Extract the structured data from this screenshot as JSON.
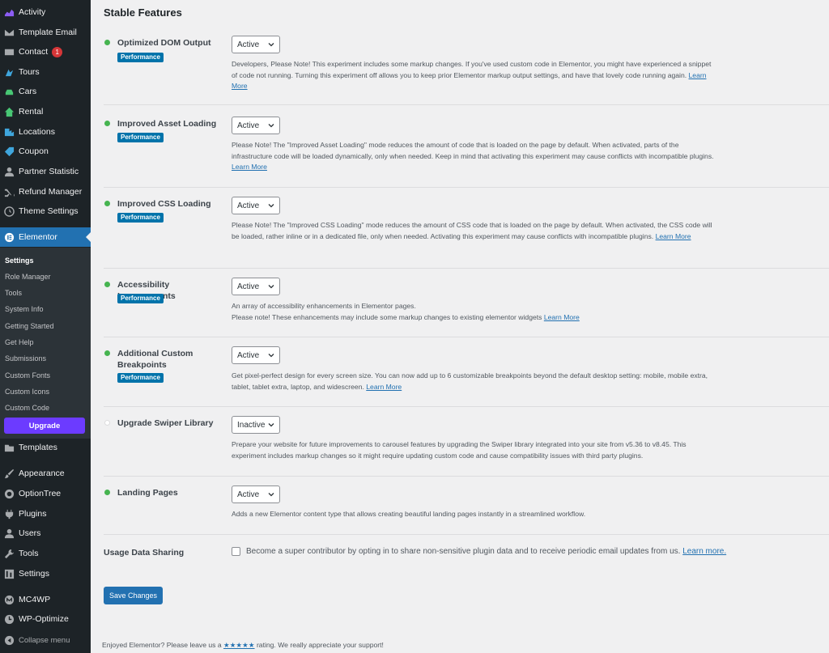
{
  "sidebar": {
    "items": [
      {
        "label": "Activity",
        "icon": "activity-icon"
      },
      {
        "label": "Template Email",
        "icon": "email-icon"
      },
      {
        "label": "Contact",
        "icon": "contact-icon",
        "badge": "1"
      },
      {
        "label": "Tours",
        "icon": "tours-icon"
      },
      {
        "label": "Cars",
        "icon": "car-icon"
      },
      {
        "label": "Rental",
        "icon": "rental-icon"
      },
      {
        "label": "Locations",
        "icon": "locations-icon"
      },
      {
        "label": "Coupon",
        "icon": "coupon-icon"
      },
      {
        "label": "Partner Statistic",
        "icon": "user-icon"
      },
      {
        "label": "Refund Manager",
        "icon": "shuffle-icon"
      },
      {
        "label": "Theme Settings",
        "icon": "settings-icon"
      },
      {
        "label": "Elementor",
        "icon": "elementor-icon",
        "current": true
      }
    ],
    "submenu": [
      {
        "label": "Settings",
        "active": true
      },
      {
        "label": "Role Manager"
      },
      {
        "label": "Tools"
      },
      {
        "label": "System Info"
      },
      {
        "label": "Getting Started"
      },
      {
        "label": "Get Help"
      },
      {
        "label": "Submissions"
      },
      {
        "label": "Custom Fonts"
      },
      {
        "label": "Custom Icons"
      },
      {
        "label": "Custom Code"
      }
    ],
    "upgrade_label": "Upgrade",
    "lower_items": [
      {
        "label": "Templates",
        "icon": "folder-icon"
      },
      {
        "label": "Appearance",
        "icon": "brush-icon"
      },
      {
        "label": "OptionTree",
        "icon": "optiontree-icon"
      },
      {
        "label": "Plugins",
        "icon": "plugin-icon"
      },
      {
        "label": "Users",
        "icon": "users-icon"
      },
      {
        "label": "Tools",
        "icon": "wrench-icon"
      },
      {
        "label": "Settings",
        "icon": "settings-sliders-icon"
      },
      {
        "label": "MC4WP",
        "icon": "mc4wp-icon"
      },
      {
        "label": "WP-Optimize",
        "icon": "optimize-icon"
      },
      {
        "label": "Collapse menu",
        "icon": "collapse-icon"
      }
    ]
  },
  "main": {
    "heading": "Stable Features",
    "tag_label": "Performance",
    "learn_more": "Learn More",
    "features": [
      {
        "name": "Optimized DOM Output",
        "status": "Active",
        "active": true,
        "tag": true,
        "desc": "Developers, Please Note! This experiment includes some markup changes. If you've used custom code in Elementor, you might have experienced a snippet of code not running. Turning this experiment off allows you to keep prior Elementor markup output settings, and have that lovely code running again."
      },
      {
        "name": "Improved Asset Loading",
        "status": "Active",
        "active": true,
        "tag": true,
        "desc": "Please Note! The \"Improved Asset Loading\" mode reduces the amount of code that is loaded on the page by default. When activated, parts of the infrastructure code will be loaded dynamically, only when needed. Keep in mind that activating this experiment may cause conflicts with incompatible plugins."
      },
      {
        "name": "Improved CSS Loading",
        "status": "Active",
        "active": true,
        "tag": true,
        "desc": "Please Note! The \"Improved CSS Loading\" mode reduces the amount of CSS code that is loaded on the page by default. When activated, the CSS code will be loaded, rather inline or in a dedicated file, only when needed. Activating this experiment may cause conflicts with incompatible plugins."
      },
      {
        "name": "Accessibility Improvements",
        "status": "Active",
        "active": true,
        "tag": true,
        "desc": "An array of accessibility enhancements in Elementor pages.",
        "desc2": "Please note! These enhancements may include some markup changes to existing elementor widgets"
      },
      {
        "name": "Additional Custom Breakpoints",
        "status": "Active",
        "active": true,
        "tag": true,
        "desc": "Get pixel-perfect design for every screen size. You can now add up to 6 customizable breakpoints beyond the default desktop setting: mobile, mobile extra, tablet, tablet extra, laptop, and widescreen."
      },
      {
        "name": "Upgrade Swiper Library",
        "status": "Inactive",
        "active": false,
        "tag": false,
        "desc": "Prepare your website for future improvements to carousel features by upgrading the Swiper library integrated into your site from v5.36 to v8.45. This experiment includes markup changes so it might require updating custom code and cause compatibility issues with third party plugins."
      },
      {
        "name": "Landing Pages",
        "status": "Active",
        "active": true,
        "tag": false,
        "desc": "Adds a new Elementor content type that allows creating beautiful landing pages instantly in a streamlined workflow."
      }
    ],
    "usage_label": "Usage Data Sharing",
    "usage_text": "Become a super contributor by opting in to share non-sensitive plugin data and to receive periodic email updates from us.",
    "usage_link": "Learn more.",
    "save_label": "Save Changes",
    "footer_before": "Enjoyed Elementor? Please leave us a",
    "footer_stars": "★★★★★",
    "footer_after": "rating. We really appreciate your support!"
  },
  "colors": {
    "sidebar_bg": "#1d2327",
    "accent": "#2271b1",
    "active_dot": "#46b450",
    "upgrade": "#6c3bff",
    "tag": "#0073aa"
  }
}
